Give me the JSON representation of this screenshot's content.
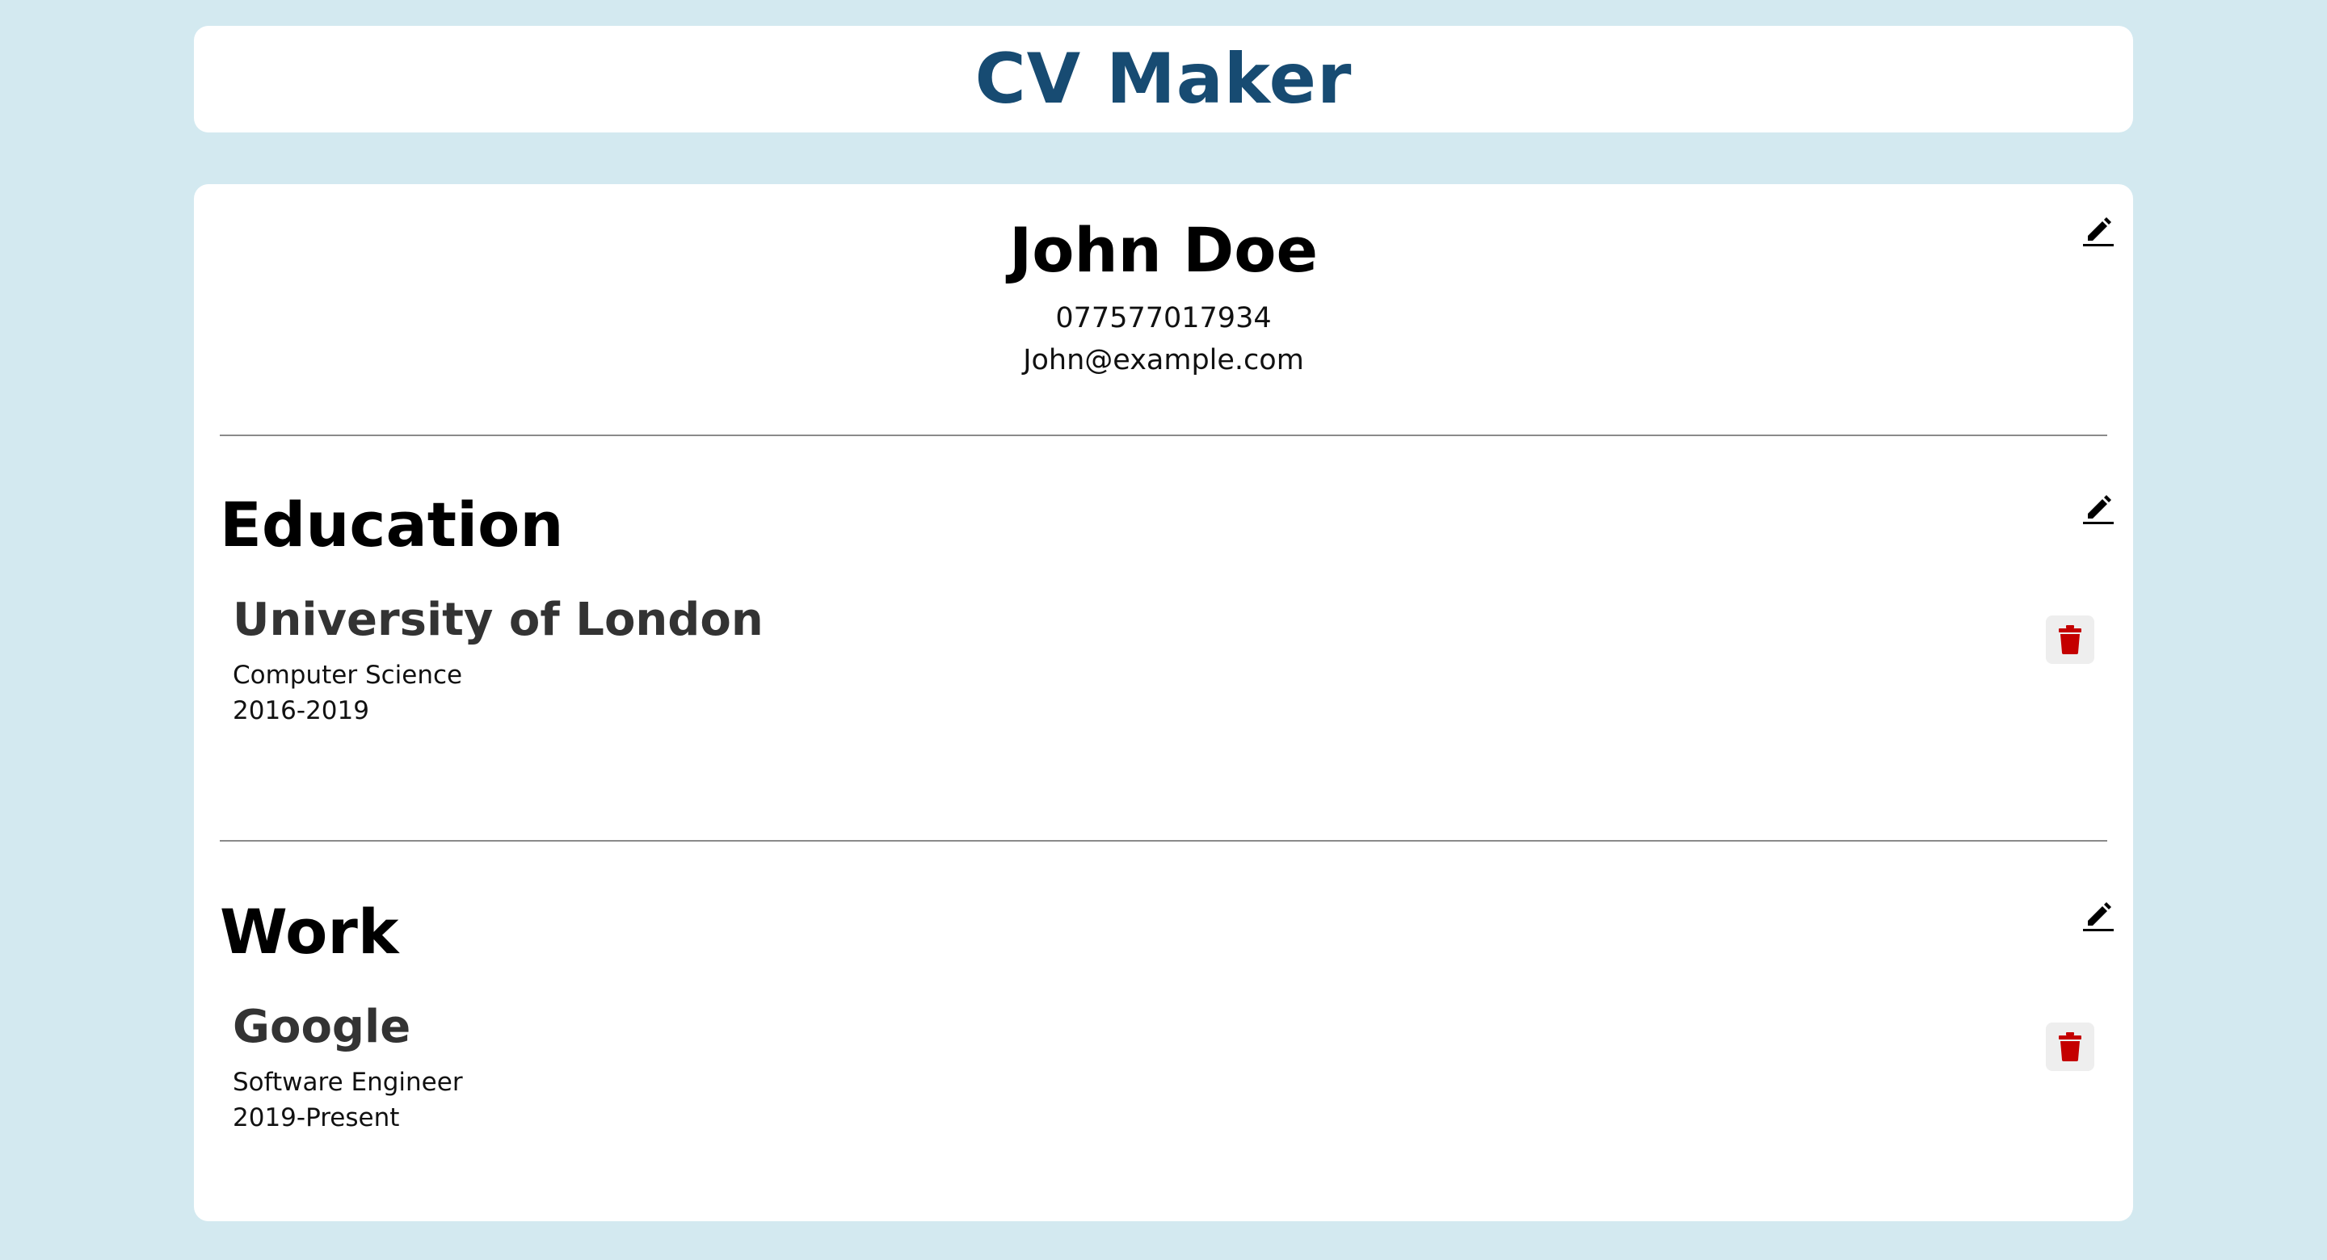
{
  "app": {
    "title": "CV Maker"
  },
  "personal": {
    "name": "John Doe",
    "phone": "077577017934",
    "email": "John@example.com",
    "edit_icon": "pencil-icon"
  },
  "education": {
    "heading": "Education",
    "edit_icon": "pencil-icon",
    "entries": [
      {
        "school": "University of London",
        "subject": "Computer Science",
        "years": "2016-2019",
        "delete_icon": "trash-icon"
      }
    ]
  },
  "work": {
    "heading": "Work",
    "edit_icon": "pencil-icon",
    "entries": [
      {
        "company": "Google",
        "position": "Software Engineer",
        "years": "2019-Present",
        "delete_icon": "trash-icon"
      }
    ]
  },
  "colors": {
    "background": "#d3e9f0",
    "title": "#174b72",
    "delete_icon": "#c40000",
    "delete_button_bg": "#eeeeee"
  }
}
